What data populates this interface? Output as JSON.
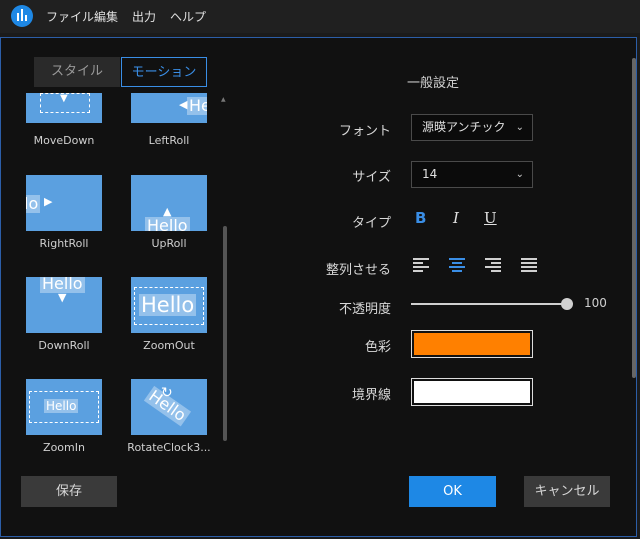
{
  "menubar": {
    "items": [
      "ファイル",
      "編集",
      "出力",
      "ヘルプ"
    ]
  },
  "tabs": {
    "style": "スタイル",
    "motion": "モーション"
  },
  "thumbnails": [
    {
      "label": "MoveDown",
      "hello": ""
    },
    {
      "label": "LeftRoll",
      "hello": "He"
    },
    {
      "label": "RightRoll",
      "hello": "lo"
    },
    {
      "label": "UpRoll",
      "hello": "Hello"
    },
    {
      "label": "DownRoll",
      "hello": "Hello"
    },
    {
      "label": "ZoomOut",
      "hello": "Hello"
    },
    {
      "label": "ZoomIn",
      "hello": "Hello"
    },
    {
      "label": "RotateClock3...",
      "hello": "Hello"
    }
  ],
  "settings": {
    "title": "一般設定",
    "font_label": "フォント",
    "font_value": "源暎アンチック",
    "size_label": "サイズ",
    "size_value": "14",
    "type_label": "タイプ",
    "bold": "B",
    "italic": "I",
    "underline": "U",
    "align_label": "整列させる",
    "opacity_label": "不透明度",
    "opacity_value": "100",
    "color_label": "色彩",
    "color_value": "#ff8000",
    "border_label": "境界線",
    "border_value": "#ffffff"
  },
  "buttons": {
    "save": "保存",
    "ok": "OK",
    "cancel": "キャンセル"
  },
  "colors": {
    "accent": "#1e88e5",
    "thumb": "#5ba0e0"
  }
}
